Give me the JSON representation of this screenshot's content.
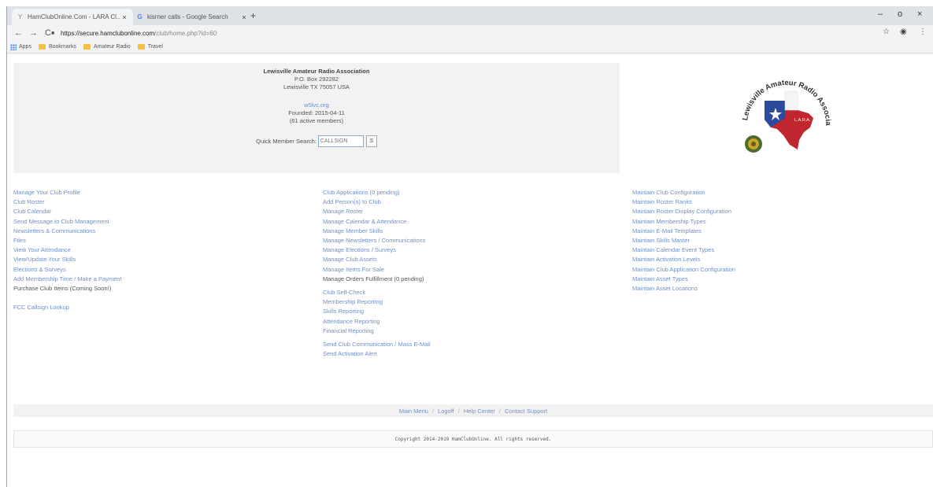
{
  "browser": {
    "tabs": [
      {
        "title": "HamClubOnline.Com - LARA Cl...",
        "close": "×"
      },
      {
        "title": "kisrner calls - Google Search",
        "close": "×"
      }
    ],
    "new_tab": "+",
    "window_controls": {
      "minimize": "–",
      "maximize": "o",
      "close": "×"
    },
    "nav": {
      "back": "←",
      "forward": "→",
      "reload": "C"
    },
    "url": {
      "host": "https://secure.hamclubonline.com",
      "path": "/club/home.php?id=60"
    },
    "bookmarks": [
      {
        "label": "Apps",
        "icon": "apps-grid-icon"
      },
      {
        "label": "Bookmarks",
        "icon": "folder-icon"
      },
      {
        "label": "Amateur Radio",
        "icon": "folder-icon"
      },
      {
        "label": "Travel",
        "icon": "folder-icon"
      }
    ]
  },
  "club": {
    "name": "Lewisville Amateur Radio Association",
    "address1": "P.O. Box 292282",
    "address2": "Lewisville TX 75057 USA",
    "website": "w5lvc.org",
    "founded": "Founded: 2015-04-11",
    "members": "(61 active members)",
    "search_label": "Quick Member Search:",
    "search_placeholder": "CALLSIGN",
    "search_button": "S",
    "logo": {
      "ring_text": "Lewisville Amateur Radio Association",
      "center_text": "L.A.R.A."
    }
  },
  "menu": {
    "left": {
      "links": [
        "Manage Your Club Profile",
        "Club Roster",
        "Club Calendar",
        "Send Message to Club Management",
        "Newsletters & Communications",
        "Files",
        "View Your Attendance",
        "View/Update Your Skills",
        "Elections & Surveys",
        "Add Membership Time / Make a Payment"
      ],
      "plain": "Purchase Club Items (Coming Soon!)",
      "extra": "FCC Callsign Lookup"
    },
    "middle": {
      "links": [
        "Club Applications (0 pending)",
        "Add Person(s) to Club",
        "Manage Roster",
        "Manage Calendar & Attendance",
        "Manage Member Skills",
        "Manage Newsletters / Communications",
        "Manage Elections / Surveys",
        "Manage Club Assets",
        "Manage Items For Sale"
      ],
      "plain": "Manage Orders Fulfillment (0 pending)",
      "reports": [
        "Club Self-Check",
        "Membership Reporting",
        "Skills Reporting",
        "Attendance Reporting",
        "Financial Reporting"
      ],
      "comms": [
        "Send Club Communication / Mass E-Mail",
        "Send Activation Alert"
      ]
    },
    "right": {
      "links": [
        "Maintain Club Configuration",
        "Maintain Roster Ranks",
        "Maintain Roster Display Configuration",
        "Maintain Membership Types",
        "Maintain E-Mail Templates",
        "Maintain Skills Master",
        "Maintain Calendar Event Types",
        "Maintain Activation Levels",
        "Maintain Club Application Configuration",
        "Maintain Asset Types",
        "Maintain Asset Locations"
      ]
    }
  },
  "footer": {
    "links": [
      "Main Menu",
      "Logoff",
      "Help Center",
      "Contact Support"
    ],
    "separator": "/",
    "copyright": "Copyright 2014-2019 HamClubOnline. All rights reserved."
  },
  "colors": {
    "link": "#6f8fc9",
    "panel": "#f2f2f2",
    "tabstrip": "#dee1e6",
    "texas_blue": "#2b4a9c",
    "texas_red": "#c0262e"
  }
}
